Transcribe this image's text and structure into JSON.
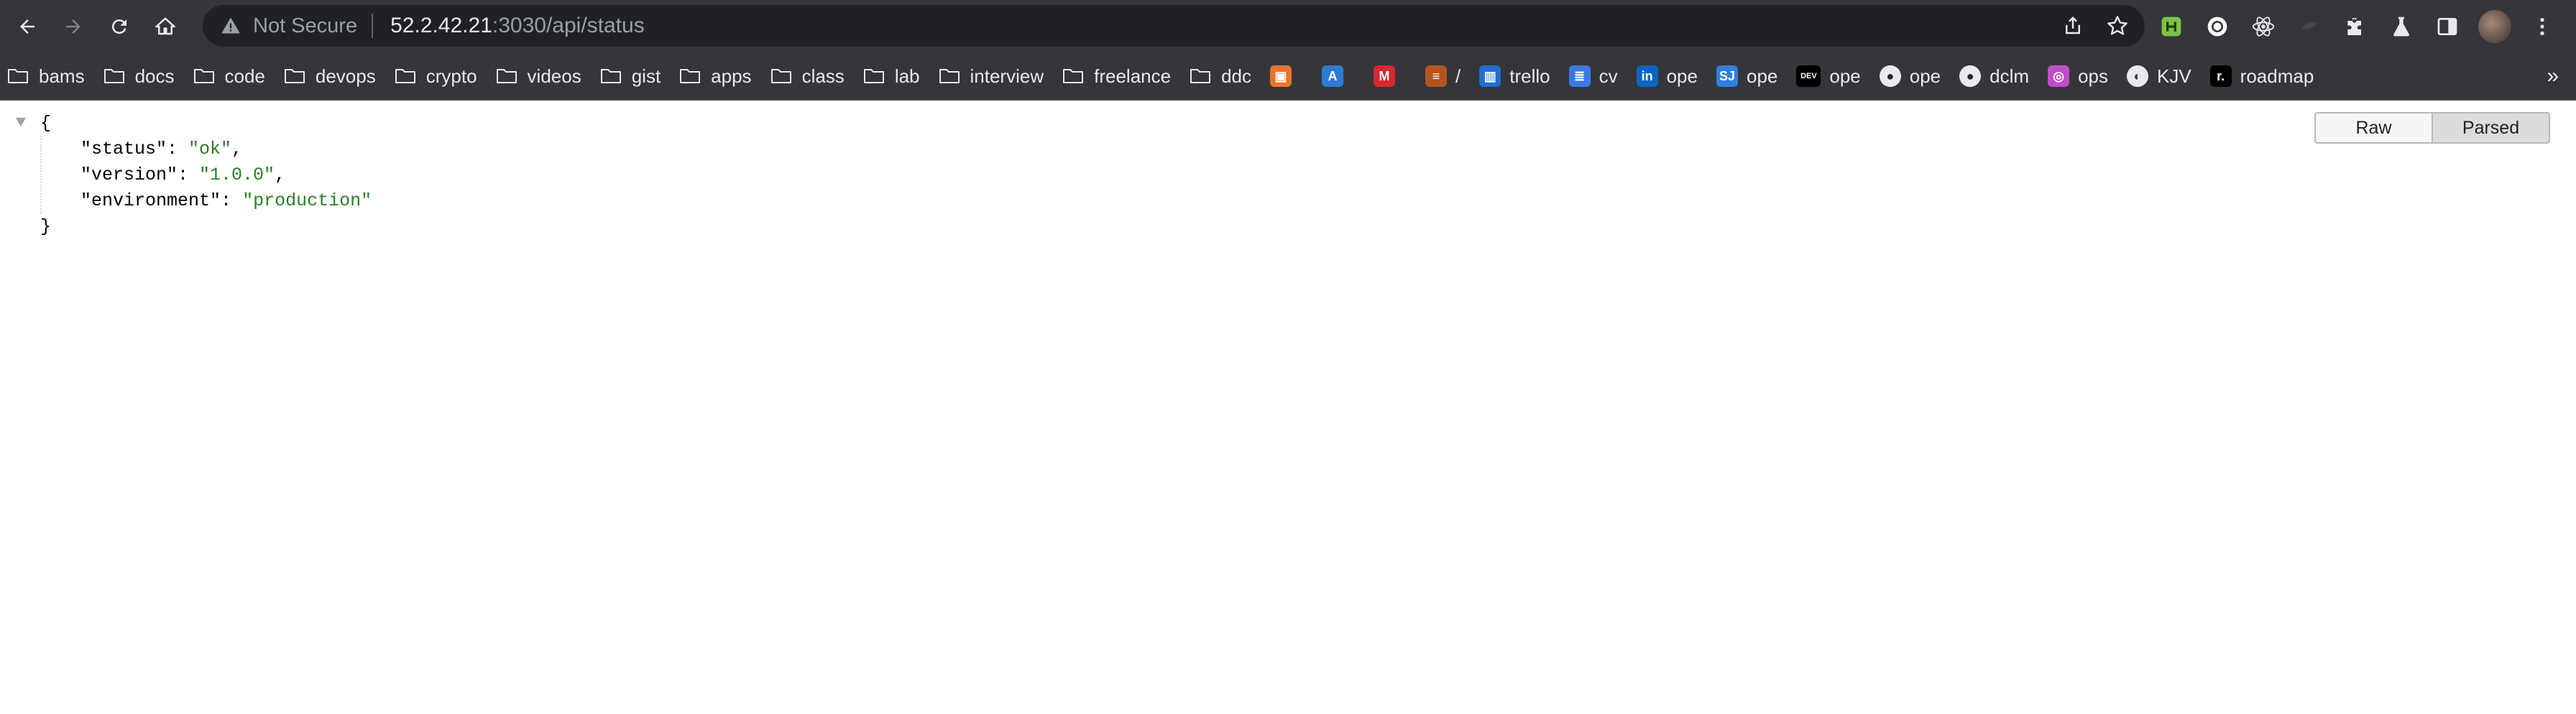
{
  "browser": {
    "security_label": "Not Secure",
    "url_host": "52.2.42.21",
    "url_path": ":3030/api/status"
  },
  "bookmarks": [
    {
      "label": "bams",
      "kind": "folder"
    },
    {
      "label": "docs",
      "kind": "folder"
    },
    {
      "label": "code",
      "kind": "folder"
    },
    {
      "label": "devops",
      "kind": "folder"
    },
    {
      "label": "crypto",
      "kind": "folder"
    },
    {
      "label": "videos",
      "kind": "folder"
    },
    {
      "label": "gist",
      "kind": "folder"
    },
    {
      "label": "apps",
      "kind": "folder"
    },
    {
      "label": "class",
      "kind": "folder"
    },
    {
      "label": "lab",
      "kind": "folder"
    },
    {
      "label": "interview",
      "kind": "folder"
    },
    {
      "label": "freelance",
      "kind": "folder"
    },
    {
      "label": "ddc",
      "kind": "folder"
    },
    {
      "label": "",
      "kind": "icon",
      "icon": "box-icon",
      "color": "#e8742a"
    },
    {
      "label": "",
      "kind": "icon",
      "icon": "azure-icon",
      "color": "#2b7cd3"
    },
    {
      "label": "",
      "kind": "icon",
      "icon": "mega-icon",
      "color": "#d9272e"
    },
    {
      "label": "/",
      "kind": "icon",
      "icon": "orange-tag-icon",
      "color": "#b5531e"
    },
    {
      "label": "trello",
      "kind": "icon",
      "icon": "trello-icon",
      "color": "#1f6fd0"
    },
    {
      "label": "cv",
      "kind": "icon",
      "icon": "google-docs-icon",
      "color": "#3b78e7"
    },
    {
      "label": "ope",
      "kind": "icon",
      "icon": "linkedin-icon",
      "color": "#0a66c2"
    },
    {
      "label": "ope",
      "kind": "icon",
      "icon": "sj-icon",
      "color": "#2f7fe0"
    },
    {
      "label": "ope",
      "kind": "icon",
      "icon": "dev-icon",
      "color": "#000000"
    },
    {
      "label": "ope",
      "kind": "icon",
      "icon": "github-icon",
      "color": "#24292e"
    },
    {
      "label": "dclm",
      "kind": "icon",
      "icon": "github-icon",
      "color": "#24292e"
    },
    {
      "label": "ops",
      "kind": "icon",
      "icon": "circle-gear-icon",
      "color": "#c04dcc"
    },
    {
      "label": "KJV",
      "kind": "icon",
      "icon": "globe-icon",
      "color": "#e8eaed"
    },
    {
      "label": "roadmap",
      "kind": "icon",
      "icon": "roadmap-icon",
      "color": "#000000"
    }
  ],
  "bookmarks_overflow": "»",
  "json_view": {
    "open_brace": "{",
    "close_brace": "}",
    "entries": [
      {
        "key": "\"status\"",
        "value": "\"ok\"",
        "comma": ","
      },
      {
        "key": "\"version\"",
        "value": "\"1.0.0\"",
        "comma": ","
      },
      {
        "key": "\"environment\"",
        "value": "\"production\"",
        "comma": ""
      }
    ]
  },
  "view_toggle": {
    "raw_label": "Raw",
    "parsed_label": "Parsed",
    "selected": "Parsed"
  }
}
